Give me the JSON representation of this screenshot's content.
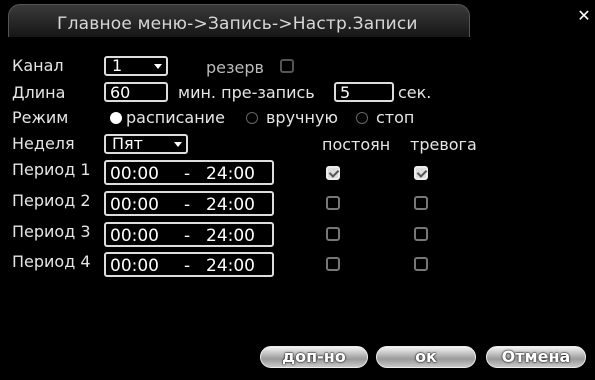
{
  "window": {
    "title": "Главное меню->Запись->Настр.Записи",
    "close_glyph": "✕"
  },
  "channel": {
    "label": "Канал",
    "value": "1",
    "reserve_label": "резерв",
    "reserve_checked": false
  },
  "length": {
    "label": "Длина",
    "value": "60",
    "unit_label": "мин. пре-запись",
    "prerecord_value": "5",
    "prerecord_unit": "сек."
  },
  "mode": {
    "label": "Режим",
    "options": [
      "расписание",
      "вручную",
      "стоп"
    ],
    "selected": "расписание"
  },
  "week": {
    "label": "Неделя",
    "value": "Пят"
  },
  "columns": {
    "constant": "постоян",
    "alarm": "тревога"
  },
  "periods": [
    {
      "label": "Период 1",
      "start": "00:00",
      "sep": "-",
      "end": "24:00",
      "constant": true,
      "alarm": true
    },
    {
      "label": "Период 2",
      "start": "00:00",
      "sep": "-",
      "end": "24:00",
      "constant": false,
      "alarm": false
    },
    {
      "label": "Период 3",
      "start": "00:00",
      "sep": "-",
      "end": "24:00",
      "constant": false,
      "alarm": false
    },
    {
      "label": "Период 4",
      "start": "00:00",
      "sep": "-",
      "end": "24:00",
      "constant": false,
      "alarm": false
    }
  ],
  "buttons": {
    "advanced": "доп-но",
    "ok": "ок",
    "cancel": "Отмена"
  },
  "icons": {
    "dropdown": "chevron-down-icon",
    "close": "close-icon"
  }
}
